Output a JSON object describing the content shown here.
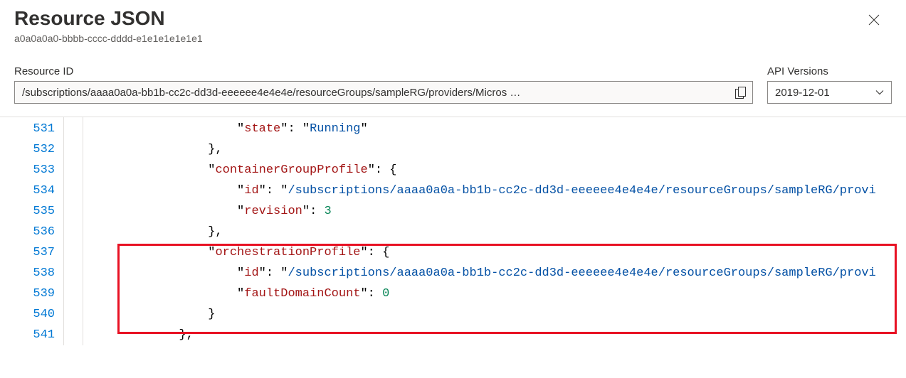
{
  "header": {
    "title": "Resource JSON",
    "subtitle": "a0a0a0a0-bbbb-cccc-dddd-e1e1e1e1e1e1"
  },
  "fields": {
    "resource_id_label": "Resource ID",
    "resource_id_value": "/subscriptions/aaaa0a0a-bb1b-cc2c-dd3d-eeeeee4e4e4e/resourceGroups/sampleRG/providers/Micros …",
    "api_versions_label": "API Versions",
    "api_version_value": "2019-12-01"
  },
  "code": {
    "lines": [
      {
        "num": "531",
        "indent": 10,
        "tokens": [
          {
            "t": "p",
            "v": "\""
          },
          {
            "t": "k",
            "v": "state"
          },
          {
            "t": "p",
            "v": "\": \""
          },
          {
            "t": "s",
            "v": "Running"
          },
          {
            "t": "p",
            "v": "\""
          }
        ]
      },
      {
        "num": "532",
        "indent": 8,
        "tokens": [
          {
            "t": "p",
            "v": "},"
          }
        ]
      },
      {
        "num": "533",
        "indent": 8,
        "tokens": [
          {
            "t": "p",
            "v": "\""
          },
          {
            "t": "k",
            "v": "containerGroupProfile"
          },
          {
            "t": "p",
            "v": "\": {"
          }
        ]
      },
      {
        "num": "534",
        "indent": 10,
        "tokens": [
          {
            "t": "p",
            "v": "\""
          },
          {
            "t": "k",
            "v": "id"
          },
          {
            "t": "p",
            "v": "\": \""
          },
          {
            "t": "s",
            "v": "/subscriptions/aaaa0a0a-bb1b-cc2c-dd3d-eeeeee4e4e4e/resourceGroups/sampleRG/provi"
          }
        ]
      },
      {
        "num": "535",
        "indent": 10,
        "tokens": [
          {
            "t": "p",
            "v": "\""
          },
          {
            "t": "k",
            "v": "revision"
          },
          {
            "t": "p",
            "v": "\": "
          },
          {
            "t": "n",
            "v": "3"
          }
        ]
      },
      {
        "num": "536",
        "indent": 8,
        "tokens": [
          {
            "t": "p",
            "v": "},"
          }
        ]
      },
      {
        "num": "537",
        "indent": 8,
        "tokens": [
          {
            "t": "p",
            "v": "\""
          },
          {
            "t": "k",
            "v": "orchestrationProfile"
          },
          {
            "t": "p",
            "v": "\": {"
          }
        ]
      },
      {
        "num": "538",
        "indent": 10,
        "tokens": [
          {
            "t": "p",
            "v": "\""
          },
          {
            "t": "k",
            "v": "id"
          },
          {
            "t": "p",
            "v": "\": \""
          },
          {
            "t": "s",
            "v": "/subscriptions/aaaa0a0a-bb1b-cc2c-dd3d-eeeeee4e4e4e/resourceGroups/sampleRG/provi"
          }
        ]
      },
      {
        "num": "539",
        "indent": 10,
        "tokens": [
          {
            "t": "p",
            "v": "\""
          },
          {
            "t": "k",
            "v": "faultDomainCount"
          },
          {
            "t": "p",
            "v": "\": "
          },
          {
            "t": "n",
            "v": "0"
          }
        ]
      },
      {
        "num": "540",
        "indent": 8,
        "tokens": [
          {
            "t": "p",
            "v": "}"
          }
        ]
      },
      {
        "num": "541",
        "indent": 6,
        "tokens": [
          {
            "t": "p",
            "v": "},"
          }
        ]
      }
    ]
  }
}
